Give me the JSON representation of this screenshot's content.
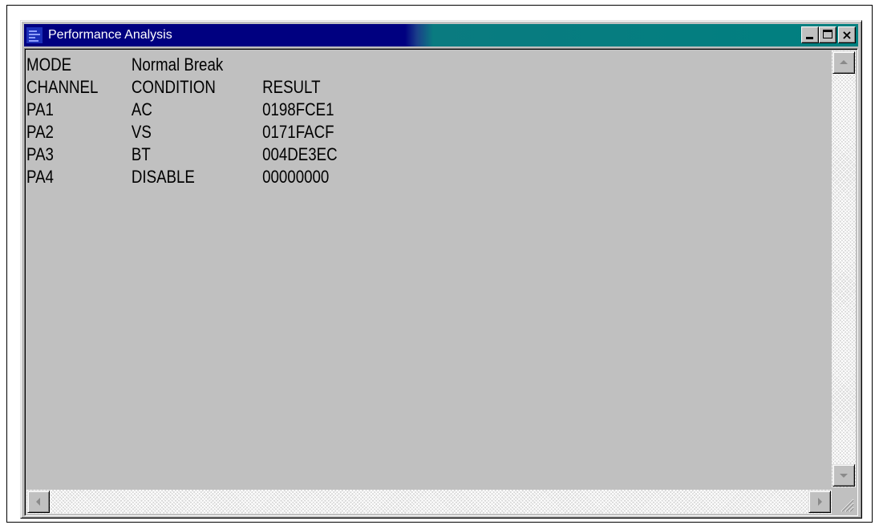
{
  "window": {
    "title": "Performance Analysis",
    "icon": "app-icon",
    "buttons": {
      "minimize": "minimize-icon",
      "maximize": "maximize-icon",
      "close": "close-icon"
    }
  },
  "content": {
    "mode_label": "MODE",
    "mode_value": "Normal Break",
    "headers": [
      "CHANNEL",
      "CONDITION",
      "RESULT"
    ],
    "rows": [
      [
        "PA1",
        "AC",
        "0198FCE1"
      ],
      [
        "PA2",
        "VS",
        "0171FACF"
      ],
      [
        "PA3",
        "BT",
        "004DE3EC"
      ],
      [
        "PA4",
        "DISABLE",
        "00000000"
      ]
    ]
  },
  "colors": {
    "title_active": "#000080",
    "title_inactive": "#008080",
    "face": "#c0c0c0"
  }
}
